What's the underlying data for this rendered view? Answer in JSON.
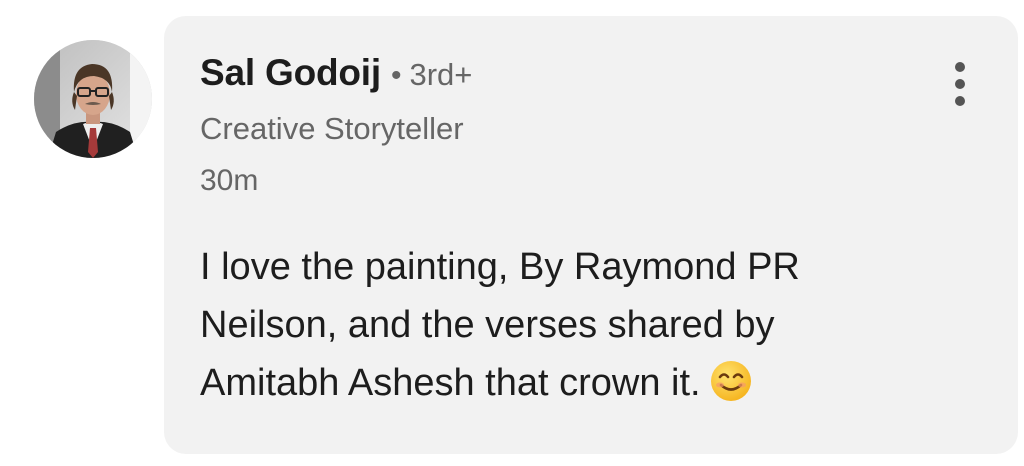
{
  "comment": {
    "author": {
      "name": "Sal Godoij",
      "separator": "•",
      "degree": "3rd+",
      "headline": "Creative Storyteller",
      "avatar_icon": "profile-photo"
    },
    "timestamp": "30m",
    "text_lines": [
      "I love the painting, By Raymond PR",
      "Neilson, and the verses shared by",
      "Amitabh Ashesh that crown it."
    ],
    "emoji_icon": "smiling-face-emoji",
    "more_menu_icon": "vertical-ellipsis-icon"
  },
  "colors": {
    "bubble_background": "#f2f2f2",
    "primary_text": "#1d1d1d",
    "secondary_text": "#666666"
  }
}
